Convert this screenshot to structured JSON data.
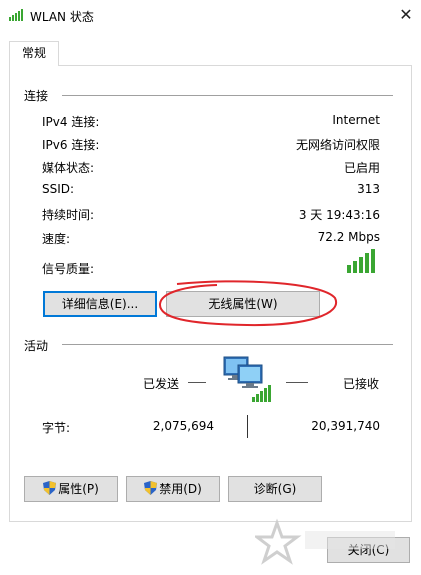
{
  "window": {
    "title": "WLAN 状态",
    "close_glyph": "✕"
  },
  "tab": {
    "label": "常规"
  },
  "connection": {
    "section_label": "连接",
    "rows": [
      {
        "label": "IPv4 连接:",
        "value": "Internet"
      },
      {
        "label": "IPv6 连接:",
        "value": "无网络访问权限"
      },
      {
        "label": "媒体状态:",
        "value": "已启用"
      },
      {
        "label": "SSID:",
        "value": "313"
      },
      {
        "label": "持续时间:",
        "value": "3 天 19:43:16"
      },
      {
        "label": "速度:",
        "value": "72.2 Mbps"
      }
    ],
    "signal_label": "信号质量:",
    "signal_bars": 5,
    "details_button": "详细信息(E)...",
    "wireless_props_button": "无线属性(W)"
  },
  "activity": {
    "section_label": "活动",
    "sent_label": "已发送",
    "received_label": "已接收",
    "bytes_label": "字节:",
    "bytes_sent": "2,075,694",
    "bytes_received": "20,391,740"
  },
  "buttons": {
    "properties": "属性(P)",
    "disable": "禁用(D)",
    "diagnose": "诊断(G)",
    "close": "关闭(C)"
  },
  "colors": {
    "accent": "#0078d7",
    "signal": "#3aa632",
    "annotation": "#e0262b"
  },
  "icons": {
    "title": "signal-icon",
    "shield": "shield-icon",
    "network": "computer-icon"
  }
}
